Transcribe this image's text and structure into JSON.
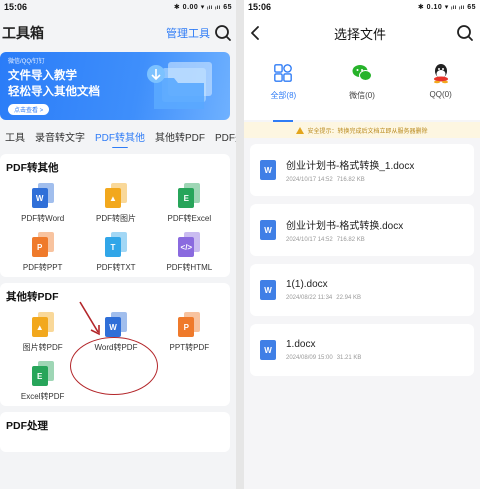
{
  "left": {
    "status": {
      "time": "15:06",
      "indicators": "✱ 0.00 ▾ ᵢₗₗ ᵢₗₗ 65"
    },
    "header": {
      "title": "工具箱",
      "manage_label": "管理工具"
    },
    "banner": {
      "small_text": "微信/QQ/钉钉",
      "line1": "文件导入教学",
      "line2": "轻松导入其他文档",
      "button_label": "点击查看 >"
    },
    "tabs": [
      "工具",
      "录音转文字",
      "PDF转其他",
      "其他转PDF",
      "PDF处"
    ],
    "active_tab": 2,
    "sections": [
      {
        "title": "PDF转其他",
        "tools": [
          {
            "label": "PDF转Word",
            "glyph": "W",
            "color": "#2f6fd8"
          },
          {
            "label": "PDF转图片",
            "glyph": "▲",
            "color": "#f2a81d"
          },
          {
            "label": "PDF转Excel",
            "glyph": "E",
            "color": "#27a55a"
          },
          {
            "label": "PDF转PPT",
            "glyph": "P",
            "color": "#ef7a2b"
          },
          {
            "label": "PDF转TXT",
            "glyph": "T",
            "color": "#31a6e8"
          },
          {
            "label": "PDF转HTML",
            "glyph": "</>",
            "color": "#8a6adf"
          }
        ]
      },
      {
        "title": "其他转PDF",
        "tools": [
          {
            "label": "图片转PDF",
            "glyph": "▲",
            "color": "#f2a81d"
          },
          {
            "label": "Word转PDF",
            "glyph": "W",
            "color": "#2f6fd8"
          },
          {
            "label": "PPT转PDF",
            "glyph": "P",
            "color": "#ef7a2b"
          },
          {
            "label": "Excel转PDF",
            "glyph": "E",
            "color": "#27a55a"
          }
        ]
      },
      {
        "title": "PDF处理",
        "tools": []
      }
    ]
  },
  "right": {
    "status": {
      "time": "15:06",
      "indicators": "✱ 0.10 ▾ ᵢₗₗ ᵢₗₗ 65"
    },
    "header": {
      "title": "选择文件"
    },
    "categories": [
      {
        "label": "全部(8)",
        "icon": "grid-icon"
      },
      {
        "label": "微信(0)",
        "icon": "wechat-icon"
      },
      {
        "label": "QQ(0)",
        "icon": "qq-icon"
      }
    ],
    "active_category": 0,
    "notice": "安全提示：转换完成后文档立即从服务器删除",
    "files": [
      {
        "name": "创业计划书-格式转换_1.docx",
        "date": "2024/10/17 14:52",
        "size": "716.82 KB"
      },
      {
        "name": "创业计划书-格式转换.docx",
        "date": "2024/10/17 14:52",
        "size": "716.82 KB"
      },
      {
        "name": "1(1).docx",
        "date": "2024/08/22 11:34",
        "size": "22.94 KB"
      },
      {
        "name": "1.docx",
        "date": "2024/08/09 15:00",
        "size": "31.21 KB"
      }
    ],
    "file_glyph": "W"
  },
  "colors": {
    "accent": "#2f7cf6",
    "annotation": "#b3262a",
    "notice_bg": "#fdf6e1"
  }
}
